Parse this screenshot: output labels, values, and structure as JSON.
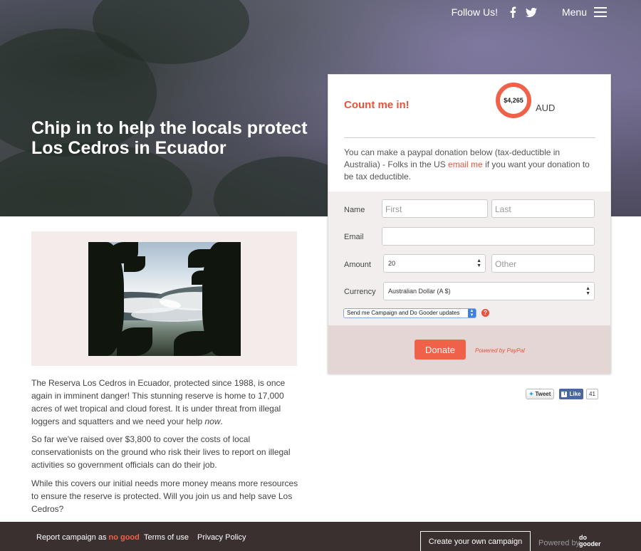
{
  "header": {
    "follow_label": "Follow Us!",
    "social_icons": [
      "facebook-icon",
      "twitter-icon"
    ],
    "menu_label": "Menu"
  },
  "hero": {
    "title": "Chip in to help the locals protect Los Cedros in Ecuador"
  },
  "donate_card": {
    "title": "Count me in!",
    "raised_amount": "$4,265",
    "currency": "AUD",
    "description_before": "You can make a paypal donation below (tax-deductible in Australia) - Folks in the US ",
    "description_link": "email me",
    "description_after": " if you want your donation to be tax deductible.",
    "form": {
      "name_label": "Name",
      "first_placeholder": "First",
      "last_placeholder": "Last",
      "email_label": "Email",
      "email_value": "",
      "amount_label": "Amount",
      "amount_selected": "20",
      "other_placeholder": "Other",
      "currency_label": "Currency",
      "currency_selected": "Australian Dollar (A $)",
      "updates_selected": "Send me Campaign and Do Gooder updates",
      "help_symbol": "?"
    },
    "donate_button": "Donate",
    "powered_by": "Powered by PayPal"
  },
  "share": {
    "tweet_label": "Tweet",
    "like_label": "Like",
    "like_count": "41"
  },
  "content": {
    "para1_a": "The Reserva Los Cedros in Ecuador, protected since 1988, is once again in imminent danger! This stunning reserve is home to 17,000 acres of wet tropical and cloud forest. It is under threat from illegal loggers and squatters and we need your help ",
    "para1_em": "now",
    "para1_b": ".",
    "para2": "So far we've raised over $3,800 to cover the costs of local conservationists on the ground who risk their lives to report on illegal activities so government officials can do their job.",
    "para3": "While this covers our initial needs more money means more resources to ensure the reserve is protected. Will you join us and help save Los Cedros?"
  },
  "footer": {
    "report_prefix": "Report campaign as ",
    "report_highlight": "no good",
    "terms": "Terms of use",
    "privacy": "Privacy Policy",
    "create_button": "Create your own campaign",
    "powered_by": "Powered by",
    "logo_line1": "do",
    "logo_line2": "gooder"
  },
  "colors": {
    "accent": "#f0614a",
    "footer_bg": "#3a3030",
    "form_bg": "#f3eeee",
    "donate_bg": "#e4d6d5"
  }
}
